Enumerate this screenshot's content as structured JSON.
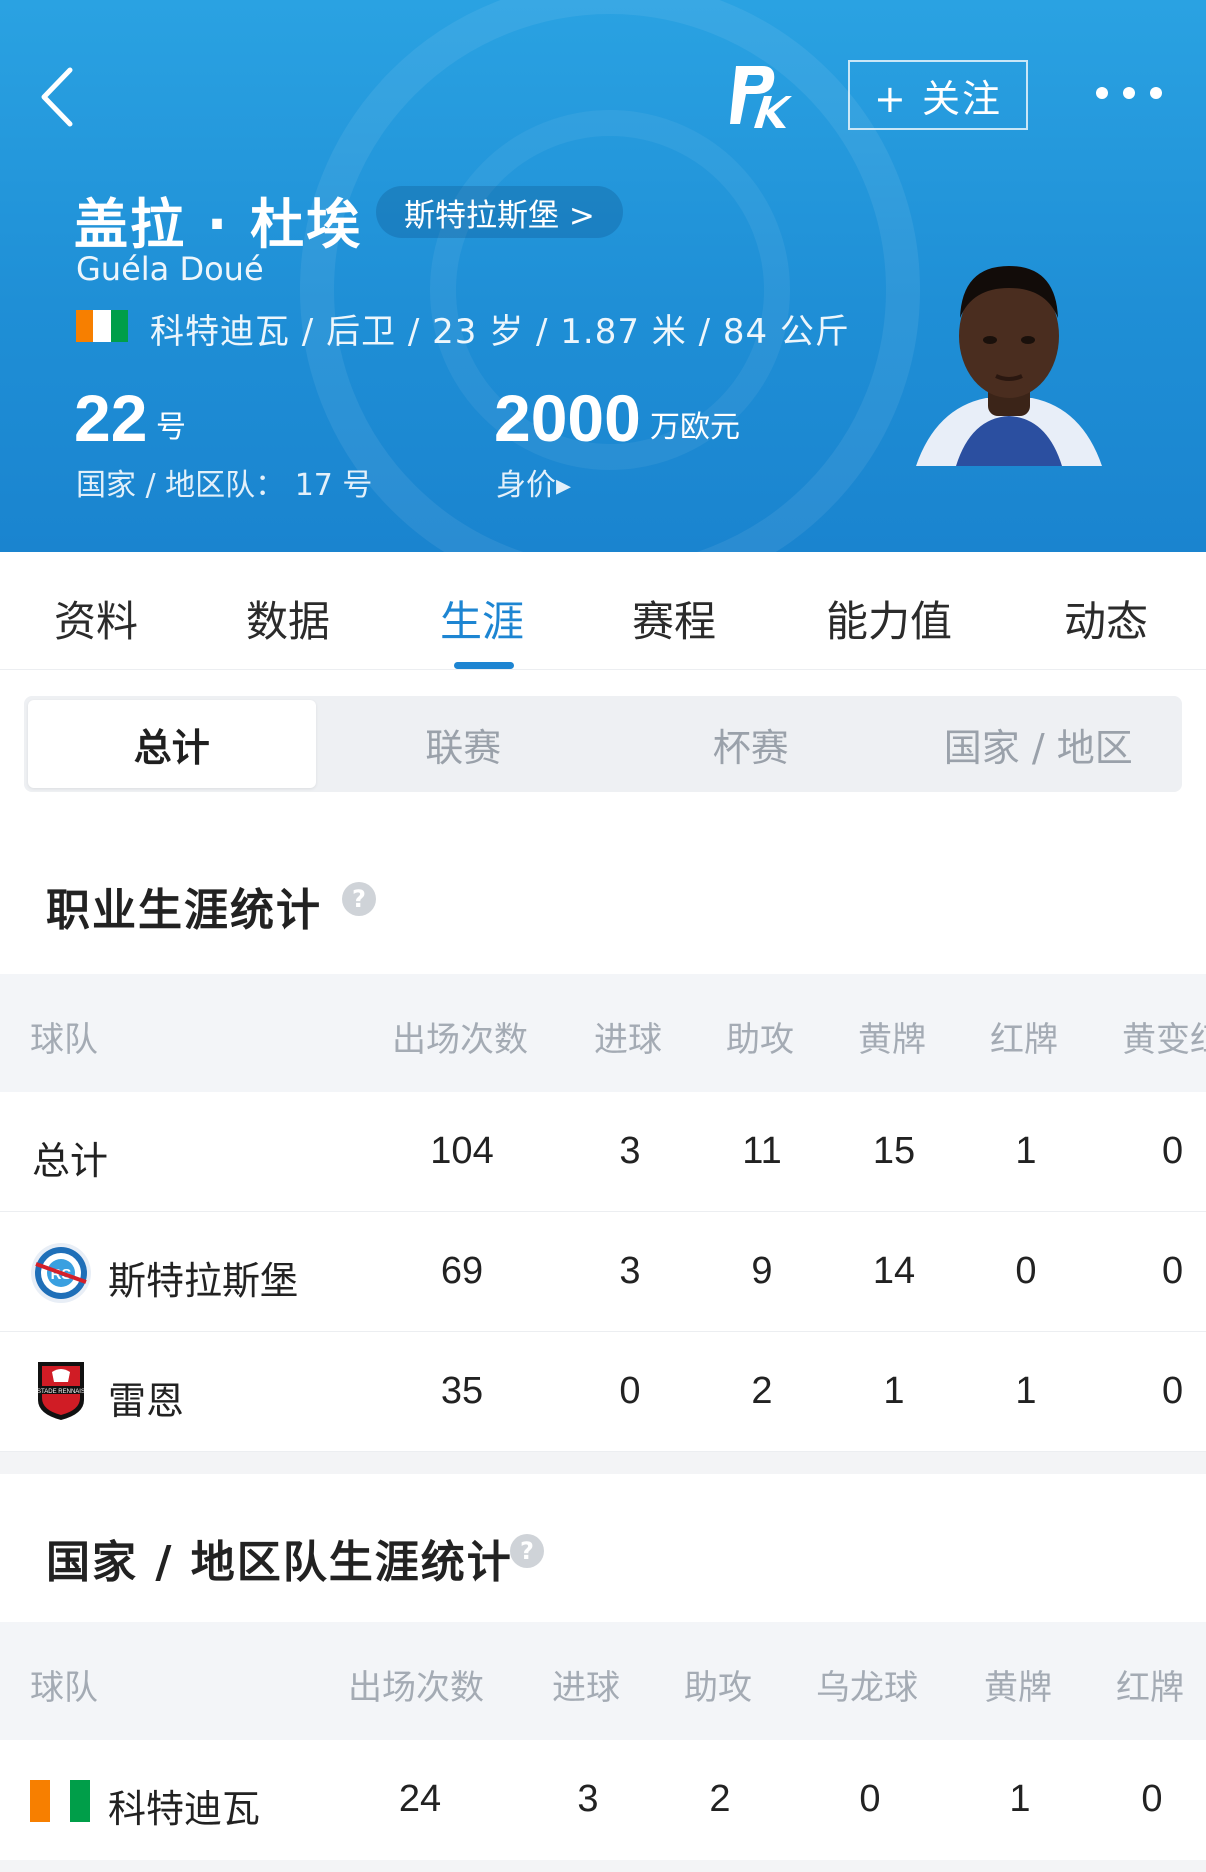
{
  "header": {
    "follow_label": "+ 关注",
    "player_name_cn": "盖拉 · 杜埃",
    "club_chip": "斯特拉斯堡 >",
    "player_name_en": "Guéla Doué",
    "meta": "科特迪瓦 / 后卫 / 23 岁 / 1.87 米 / 84 公斤",
    "shirt_number": "22",
    "shirt_unit": "号",
    "national_number": "国家 / 地区队：  17 号",
    "market_value": "2000",
    "market_value_unit": "万欧元",
    "market_value_label": "身价▸",
    "flag_colors": [
      "#f77f00",
      "#ffffff",
      "#009e49"
    ]
  },
  "tabs": [
    {
      "label": "资料"
    },
    {
      "label": "数据"
    },
    {
      "label": "生涯",
      "active": true
    },
    {
      "label": "赛程"
    },
    {
      "label": "能力值"
    },
    {
      "label": "动态"
    }
  ],
  "segments": [
    {
      "label": "总计",
      "active": true
    },
    {
      "label": "联赛"
    },
    {
      "label": "杯赛"
    },
    {
      "label": "国家 / 地区"
    }
  ],
  "club_career": {
    "title": "职业生涯统计",
    "columns": [
      "球队",
      "出场次数",
      "进球",
      "助攻",
      "黄牌",
      "红牌",
      "黄变红"
    ],
    "rows": [
      {
        "team": "总计",
        "values": [
          "104",
          "3",
          "11",
          "15",
          "1",
          "0"
        ]
      },
      {
        "team": "斯特拉斯堡",
        "icon": "strasbourg-crest-icon",
        "values": [
          "69",
          "3",
          "9",
          "14",
          "0",
          "0"
        ]
      },
      {
        "team": "雷恩",
        "icon": "rennes-crest-icon",
        "values": [
          "35",
          "0",
          "2",
          "1",
          "1",
          "0"
        ]
      }
    ]
  },
  "national_career": {
    "title": "国家 / 地区队生涯统计",
    "columns": [
      "球队",
      "出场次数",
      "进球",
      "助攻",
      "乌龙球",
      "黄牌",
      "红牌"
    ],
    "rows": [
      {
        "team": "科特迪瓦",
        "icon": "ivory-coast-flag-icon",
        "values": [
          "24",
          "3",
          "2",
          "0",
          "1",
          "0"
        ]
      }
    ]
  },
  "colors": {
    "accent": "#1d85d2",
    "header_bg": "#2299dc"
  }
}
